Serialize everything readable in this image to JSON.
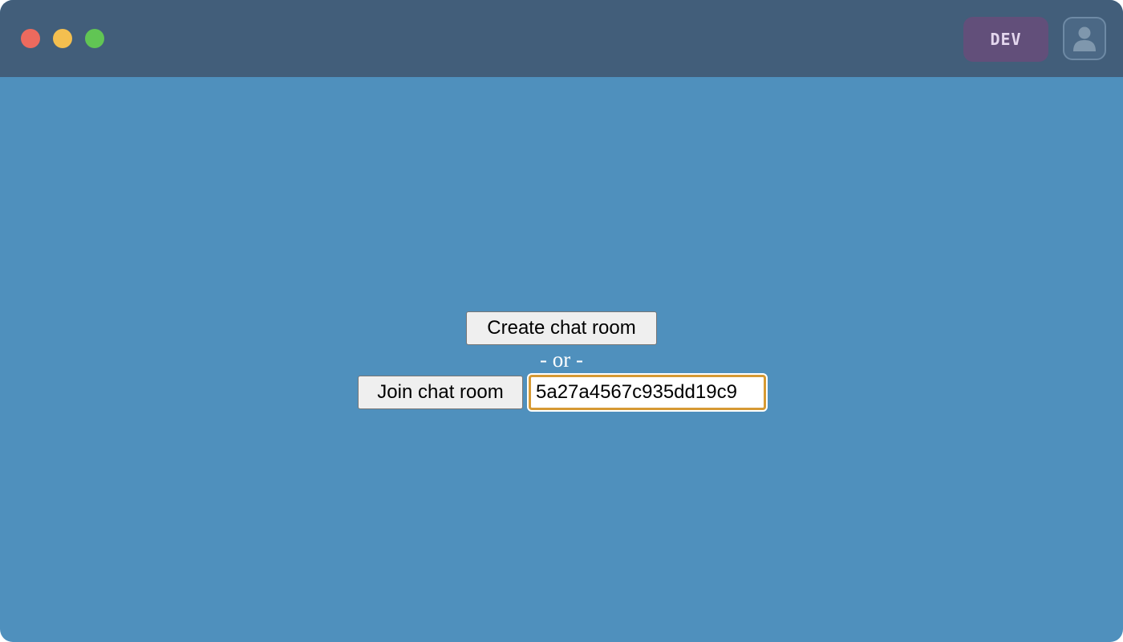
{
  "window": {
    "title_bar": {
      "environment_badge": "DEV",
      "icons": {
        "close": "close-circle",
        "minimize": "minimize-circle",
        "zoom": "zoom-circle",
        "profile": "user-icon"
      }
    }
  },
  "main": {
    "create_button_label": "Create chat room",
    "separator_text": "- or -",
    "join_button_label": "Join chat room",
    "room_id_input": {
      "value": "5a27a4567c935dd19c9",
      "placeholder": ""
    }
  },
  "colors": {
    "background": "#4f90bd",
    "title_bar": "#425e7a",
    "badge_background": "#624f7a",
    "focus_ring": "#d69a34",
    "traffic_close": "#ed6a5e",
    "traffic_minimize": "#f4bf4f",
    "traffic_zoom": "#61c554"
  }
}
